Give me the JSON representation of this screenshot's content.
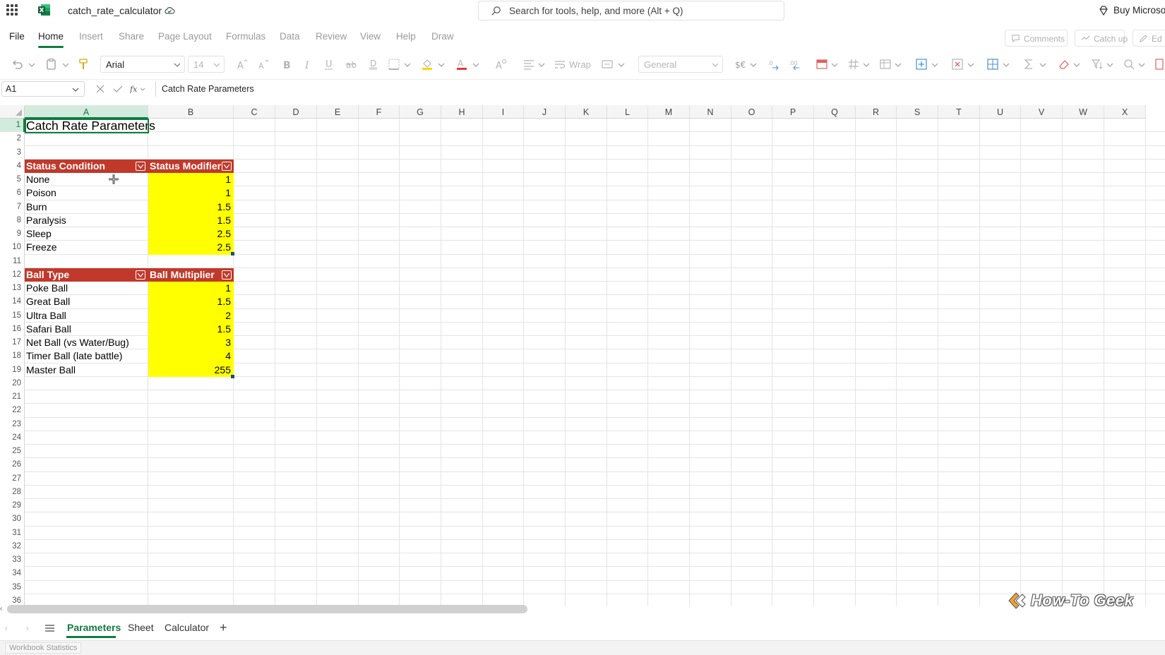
{
  "app": {
    "doc_title": "catch_rate_calculator",
    "search_placeholder": "Search for tools, help, and more (Alt + Q)",
    "buy_label": "Buy Microso"
  },
  "menu": {
    "tabs": [
      "File",
      "Home",
      "Insert",
      "Share",
      "Page Layout",
      "Formulas",
      "Data",
      "Review",
      "View",
      "Help",
      "Draw"
    ],
    "active": "Home",
    "comments_label": "Comments",
    "catchup_label": "Catch up",
    "edit_label": "Ed"
  },
  "ribbon": {
    "font_name": "Arial",
    "font_size": "14",
    "wrap_label": "Wrap",
    "number_format": "General"
  },
  "formula_bar": {
    "name_box": "A1",
    "formula": "Catch Rate Parameters"
  },
  "grid": {
    "columns": [
      "A",
      "B",
      "C",
      "D",
      "E",
      "F",
      "G",
      "H",
      "I",
      "J",
      "K",
      "L",
      "M",
      "N",
      "O",
      "P",
      "Q",
      "R",
      "S",
      "T",
      "U",
      "V",
      "W",
      "X"
    ],
    "rows": [
      "1",
      "2",
      "3",
      "4",
      "5",
      "6",
      "7",
      "8",
      "9",
      "10",
      "11",
      "12",
      "13",
      "14",
      "15",
      "16",
      "17",
      "18",
      "19",
      "20",
      "21",
      "22",
      "23",
      "24",
      "25",
      "26",
      "27",
      "28",
      "29",
      "30",
      "31",
      "32",
      "33",
      "34",
      "35",
      "36"
    ],
    "selected_cell": "A1"
  },
  "sheet": {
    "title": "Catch Rate Parameters",
    "status_table": {
      "headers": [
        "Status Condition",
        "Status Modifier"
      ],
      "rows": [
        {
          "name": "None",
          "value": "1"
        },
        {
          "name": "Poison",
          "value": "1"
        },
        {
          "name": "Burn",
          "value": "1.5"
        },
        {
          "name": "Paralysis",
          "value": "1.5"
        },
        {
          "name": "Sleep",
          "value": "2.5"
        },
        {
          "name": "Freeze",
          "value": "2.5"
        }
      ]
    },
    "ball_table": {
      "headers": [
        "Ball Type",
        "Ball Multiplier"
      ],
      "rows": [
        {
          "name": "Poke Ball",
          "value": "1"
        },
        {
          "name": "Great Ball",
          "value": "1.5"
        },
        {
          "name": "Ultra Ball",
          "value": "2"
        },
        {
          "name": "Safari Ball",
          "value": "1.5"
        },
        {
          "name": "Net Ball (vs Water/Bug)",
          "value": "3"
        },
        {
          "name": "Timer Ball (late battle)",
          "value": "4"
        },
        {
          "name": "Master Ball",
          "value": "255"
        }
      ]
    }
  },
  "sheet_tabs": {
    "tabs": [
      "Parameters",
      "Sheet",
      "Calculator"
    ],
    "active": "Parameters",
    "add_label": "+"
  },
  "status_bar": {
    "workbook_stats": "Workbook Statistics"
  },
  "watermark": {
    "text": "How-To Geek"
  },
  "colors": {
    "accent": "#107c41",
    "header_fill": "#c0392b",
    "value_fill": "#ffff00"
  }
}
